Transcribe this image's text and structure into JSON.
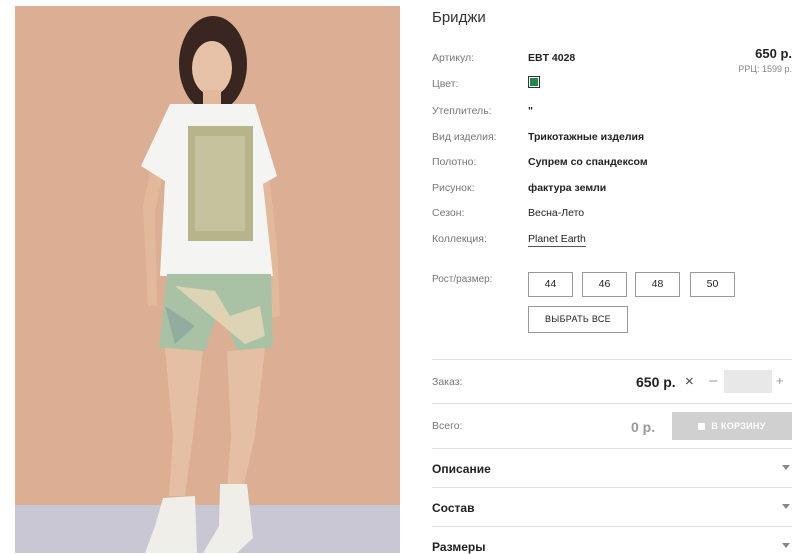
{
  "product": {
    "title": "Бриджи",
    "price": "650 р.",
    "rrp": "РРЦ: 1599 р.",
    "color_hex": "#1f8a4c"
  },
  "attributes": [
    {
      "label": "Артикул:",
      "value": "EBT 4028"
    },
    {
      "label": "Цвет:",
      "value": ""
    },
    {
      "label": "Утеплитель:",
      "value": "\""
    },
    {
      "label": "Вид изделия:",
      "value": "Трикотажные изделия"
    },
    {
      "label": "Полотно:",
      "value": "Супрем со спандексом"
    },
    {
      "label": "Рисунок:",
      "value": "фактура земли"
    },
    {
      "label": "Сезон:",
      "value": "Весна-Лето"
    },
    {
      "label": "Коллекция:",
      "value": "Planet Earth"
    }
  ],
  "sizes": {
    "label": "Рост/размер:",
    "options": [
      "44",
      "46",
      "48",
      "50"
    ],
    "select_all": "ВЫБРАТЬ ВСЕ"
  },
  "order": {
    "label": "Заказ:",
    "price": "650 р.",
    "remove": "×",
    "minus": "–",
    "quantity": "",
    "plus": "+"
  },
  "total": {
    "label": "Всего:",
    "value": "0 р.",
    "cart_button": "В КОРЗИНУ"
  },
  "sections": [
    "Описание",
    "Состав",
    "Размеры"
  ],
  "icons": {
    "cart": "shopping-bag-icon",
    "chevron": "chevron-down-icon"
  }
}
